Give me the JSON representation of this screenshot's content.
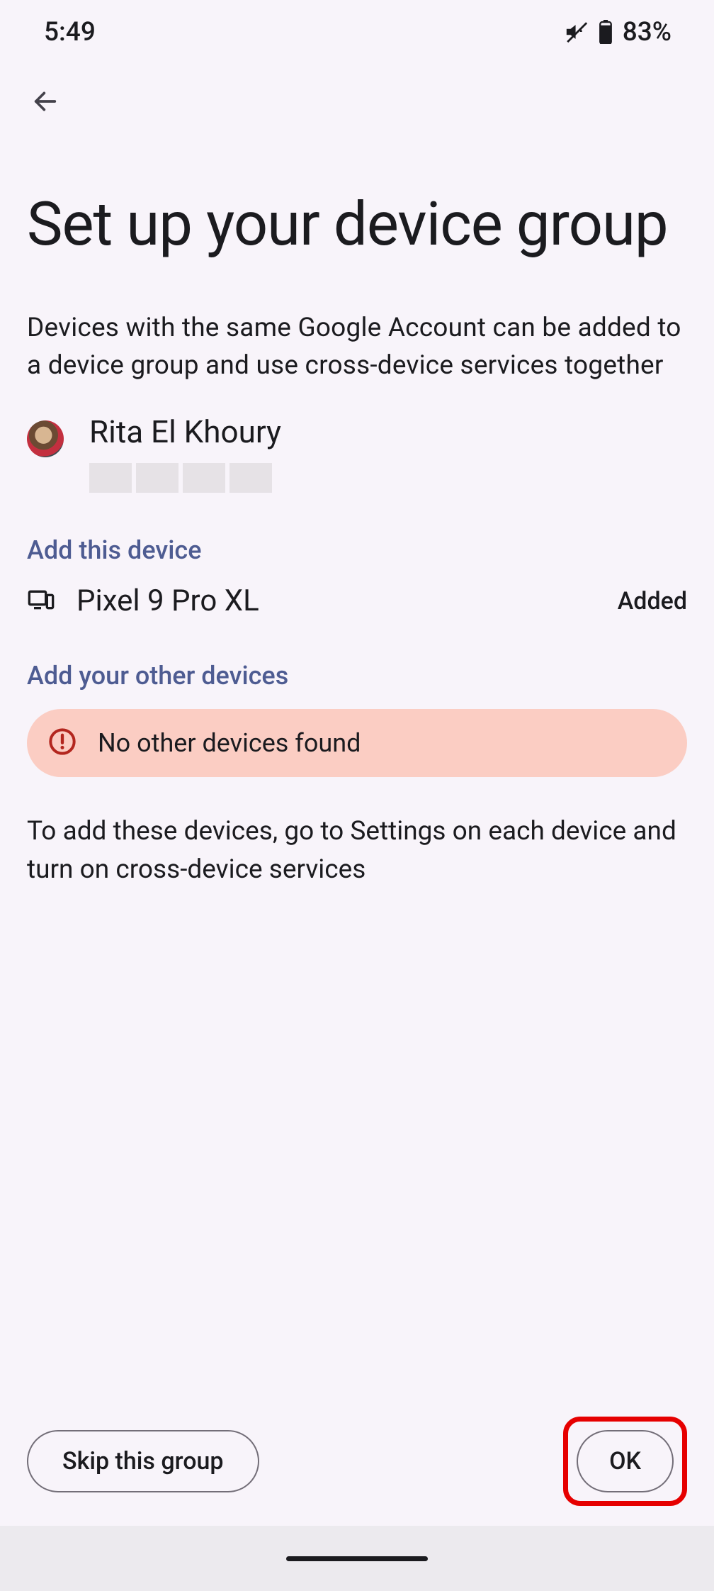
{
  "status": {
    "time": "5:49",
    "battery_pct": "83%"
  },
  "page": {
    "title": "Set up your device group",
    "subtitle": "Devices with the same Google Account can be added to a device group and use cross-device services together"
  },
  "account": {
    "name": "Rita El Khoury"
  },
  "sections": {
    "add_this_device": "Add this device",
    "add_other_devices": "Add your other devices"
  },
  "this_device": {
    "name": "Pixel 9 Pro XL",
    "status": "Added"
  },
  "warning": {
    "message": "No other devices found"
  },
  "hint": "To add these devices, go to Settings on each device and turn on cross-device services",
  "buttons": {
    "skip": "Skip this group",
    "ok": "OK"
  }
}
